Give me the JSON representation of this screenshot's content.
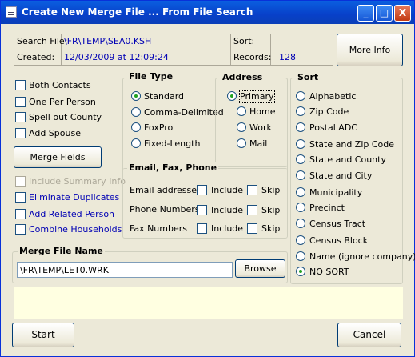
{
  "window": {
    "title": "Create New Merge File ... From File Search",
    "min_label": "_",
    "max_label": "□",
    "close_label": "X"
  },
  "header": {
    "file_label": "Search File:",
    "file_value": "\\FR\\TEMP\\SEA0.KSH",
    "sort_label": "Sort:",
    "sort_value": "",
    "created_label": "Created:",
    "created_value": "12/03/2009 at 12:09:24",
    "records_label": "Records:",
    "records_value": "128",
    "more_info": "More Info"
  },
  "options": {
    "both_contacts": "Both Contacts",
    "one_per_person": "One Per Person",
    "spell_out_county": "Spell out County",
    "add_spouse": "Add Spouse",
    "merge_fields": "Merge Fields",
    "include_summary": "Include Summary Info",
    "eliminate_dups": "Eliminate Duplicates",
    "add_related": "Add Related Person",
    "combine_households": "Combine Households"
  },
  "file_type": {
    "title": "File Type",
    "items": [
      "Standard",
      "Comma-Delimited",
      "FoxPro",
      "Fixed-Length"
    ],
    "selected": "Standard"
  },
  "address": {
    "title": "Address",
    "items": [
      "Primary",
      "Home",
      "Work",
      "Mail"
    ],
    "selected": "Primary"
  },
  "email_group": {
    "title": "Email, Fax, Phone",
    "rows": [
      {
        "label": "Email addresses",
        "include": "Include",
        "skip": "Skip"
      },
      {
        "label": "Phone Numbers",
        "include": "Include",
        "skip": "Skip"
      },
      {
        "label": "Fax Numbers",
        "include": "Include",
        "skip": "Skip"
      }
    ]
  },
  "sort": {
    "title": "Sort",
    "items": [
      "Alphabetic",
      "Zip Code",
      "Postal ADC",
      "State and Zip Code",
      "State and County",
      "State and City",
      "Municipality",
      "Precinct",
      "Census Tract",
      "Census Block",
      "Name (ignore company)",
      "NO SORT"
    ],
    "selected": "NO SORT"
  },
  "merge_file": {
    "title": "Merge File Name",
    "value": "\\FR\\TEMP\\LET0.WRK",
    "browse": "Browse"
  },
  "footer": {
    "start": "Start",
    "cancel": "Cancel"
  }
}
